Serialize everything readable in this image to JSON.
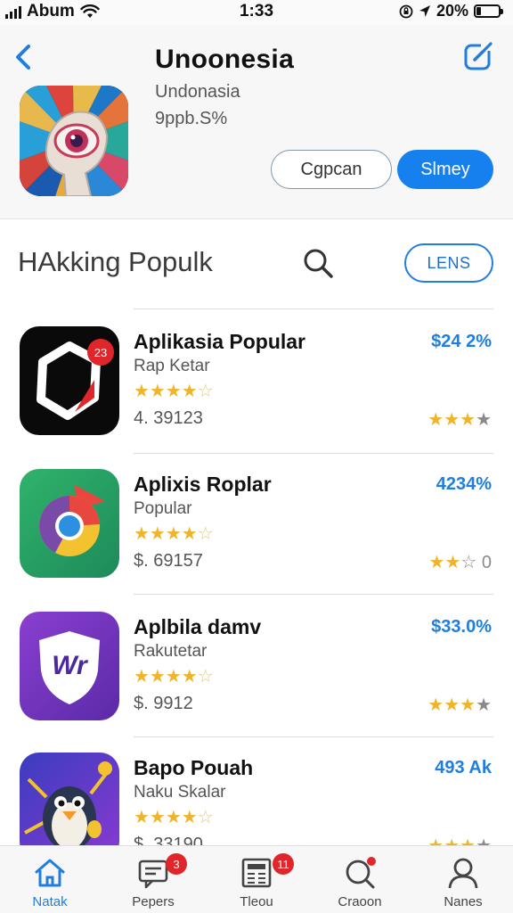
{
  "status": {
    "carrier": "Abum",
    "time": "1:33",
    "battery": "20%",
    "battery_level": 0.2
  },
  "header": {
    "title": "Unoonesia",
    "subtitle": "Undonasia",
    "size": "9ppb.S%",
    "secondary_button": "Cgpcan",
    "primary_button": "Slmey"
  },
  "section": {
    "title": "HAkking Populk",
    "button": "LENS"
  },
  "apps": [
    {
      "name": "Aplikasia Popular",
      "sub": "Rap Ketar",
      "meta": "4. 39123",
      "price": "$24 2%",
      "stars": 4,
      "rating": "★★★",
      "rating_grey": "★",
      "badge": "23"
    },
    {
      "name": "Aplixis Roplar",
      "sub": "Popular",
      "meta": "$. 69157",
      "price": "4234%",
      "stars": 4,
      "rating": "★★",
      "rating_grey": "☆ 0"
    },
    {
      "name": "Aplbila damv",
      "sub": "Rakutetar",
      "meta": "$. 9912",
      "price": "$33.0%",
      "stars": 4,
      "rating": "★★★",
      "rating_grey": "★",
      "icon_text": "Wr"
    },
    {
      "name": "Bapo Pouah",
      "sub": "Naku Skalar",
      "meta": "$. 33190",
      "price": "493 Ak",
      "stars": 4,
      "rating": "★★★",
      "rating_grey": "★"
    }
  ],
  "tabs": [
    {
      "label": "Natak",
      "icon": "home-icon",
      "active": true
    },
    {
      "label": "Pepers",
      "icon": "messages-icon",
      "badge": "3"
    },
    {
      "label": "Tleou",
      "icon": "news-icon",
      "badge": "11"
    },
    {
      "label": "Craoon",
      "icon": "search-icon",
      "dot": true
    },
    {
      "label": "Nanes",
      "icon": "profile-icon"
    }
  ],
  "colors": {
    "accent": "#1681ee",
    "star": "#f0b429",
    "badge": "#e0262a"
  }
}
